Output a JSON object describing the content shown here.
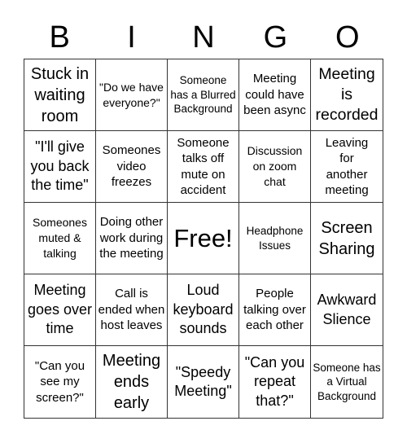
{
  "title_letters": [
    "B",
    "I",
    "N",
    "G",
    "O"
  ],
  "cells": [
    "Stuck in waiting room",
    "\"Do we have everyone?\"",
    "Someone has a Blurred Background",
    "Meeting could have been async",
    "Meeting is recorded",
    "\"I'll give you back the time\"",
    "Someones video freezes",
    "Someone talks off mute on accident",
    "Discussion on zoom chat",
    "Leaving for another meeting",
    "Someones muted & talking",
    "Doing other work during the meeting",
    "Free!",
    "Headphone Issues",
    "Screen Sharing",
    "Meeting goes over time",
    "Call is ended when host leaves",
    "Loud keyboard sounds",
    "People talking over each other",
    "Awkward Slience",
    "\"Can you see my screen?\"",
    "Meeting ends early",
    "\"Speedy Meeting\"",
    "\"Can you repeat that?\"",
    "Someone has a Virtual Background"
  ]
}
